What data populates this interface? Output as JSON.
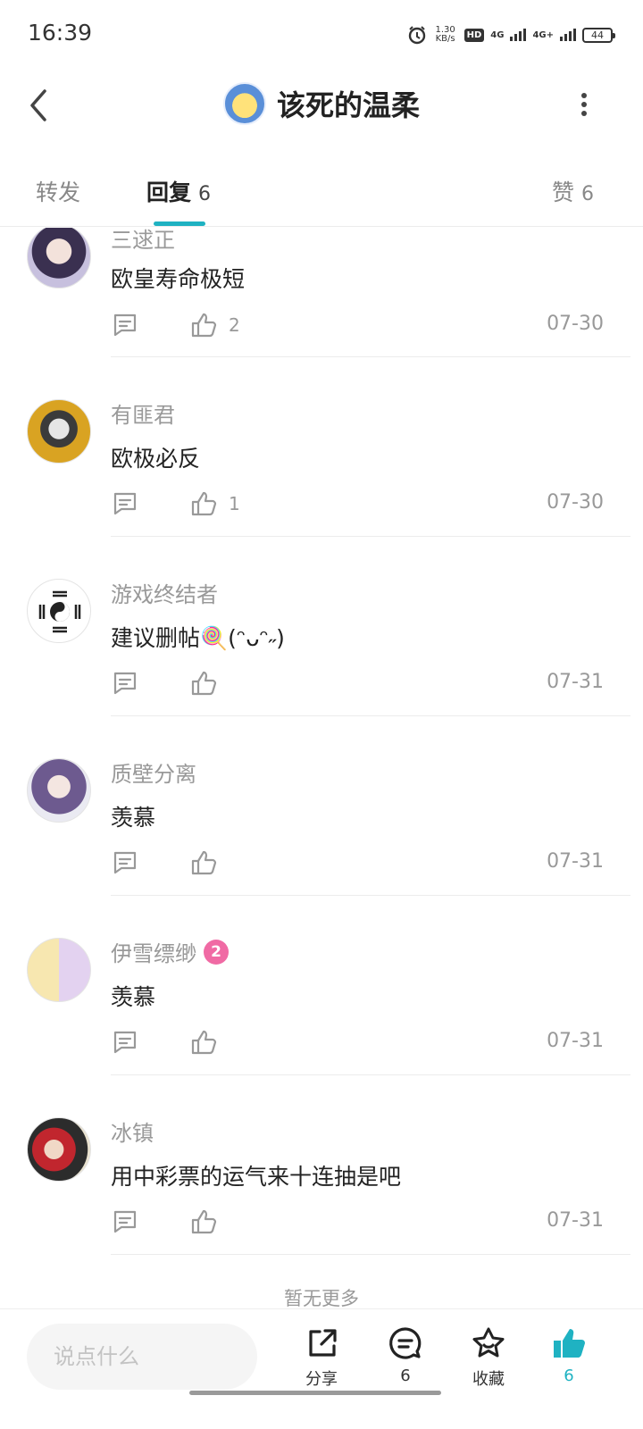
{
  "status_bar": {
    "time": "16:39",
    "net_speed_value": "1.30",
    "net_speed_unit": "KB/s",
    "network_label_1": "4G",
    "network_label_2": "4G+",
    "battery": "44",
    "icons": [
      "alarm-icon",
      "hd-icon",
      "signal-icon",
      "battery-icon"
    ]
  },
  "header": {
    "title": "该死的温柔",
    "icons": [
      "back-arrow-icon",
      "more-vertical-icon"
    ]
  },
  "tabs": {
    "forward": "转发",
    "reply": "回复",
    "reply_count": "6",
    "like": "赞",
    "like_count": "6",
    "accent_color": "#1fb2c2"
  },
  "comments": [
    {
      "name": "三逑正",
      "text": "欧皇寿命极短",
      "likes": "2",
      "date": "07-30"
    },
    {
      "name": "有匪君",
      "text": "欧极必反",
      "likes": "1",
      "date": "07-30"
    },
    {
      "name": "游戏终结者",
      "text": "建议删帖🍭(ᵔᴗᵔ˶)",
      "likes": "",
      "date": "07-31"
    },
    {
      "name": "质壁分离",
      "text": "羡慕",
      "likes": "",
      "date": "07-31"
    },
    {
      "name": "伊雪缥缈",
      "badge": "2",
      "text": "羡慕",
      "likes": "",
      "date": "07-31"
    },
    {
      "name": "冰镇",
      "text": "用中彩票的运气来十连抽是吧",
      "likes": "",
      "date": "07-31"
    }
  ],
  "no_more": "暂无更多",
  "bottom_bar": {
    "input_placeholder": "说点什么",
    "share": "分享",
    "comment_count": "6",
    "favorite": "收藏",
    "like_count": "6",
    "like_color": "#1fb2c2",
    "icons": [
      "share-icon",
      "comment-icon",
      "star-icon",
      "thumbs-up-icon"
    ]
  }
}
